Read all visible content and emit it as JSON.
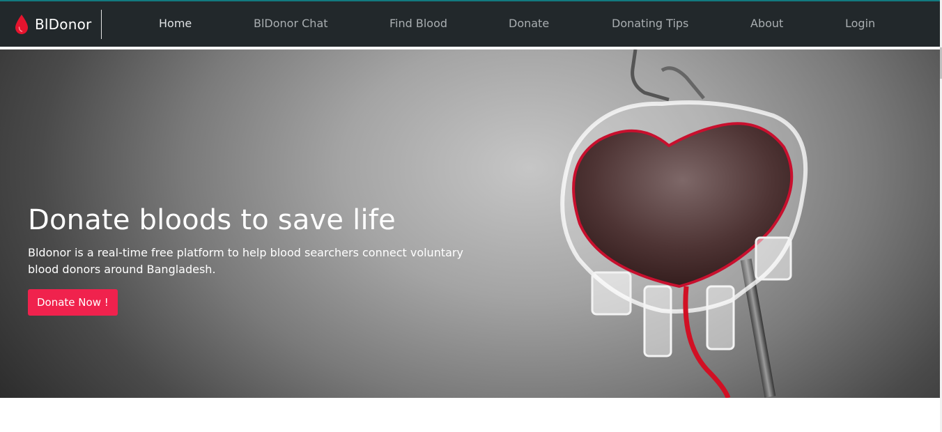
{
  "brand": {
    "name": "BlDonor",
    "icon": "blood-drop-icon",
    "color": "#e5142e"
  },
  "nav": {
    "items": [
      {
        "label": "Home",
        "active": true
      },
      {
        "label": "BlDonor Chat"
      },
      {
        "label": "Find Blood"
      },
      {
        "label": "Donate"
      },
      {
        "label": "Donating Tips"
      },
      {
        "label": "About"
      },
      {
        "label": "Login"
      }
    ]
  },
  "hero": {
    "title": "Donate bloods to save life",
    "text": "Bldonor is a real-time free platform to help blood searchers connect voluntary blood donors around Bangladesh.",
    "button_label": "Donate Now !",
    "accent": "#f0224d",
    "image": "heart-shaped-blood-bag"
  },
  "colors": {
    "navbar_bg": "#22282b",
    "nav_text": "#a9aeb1"
  }
}
